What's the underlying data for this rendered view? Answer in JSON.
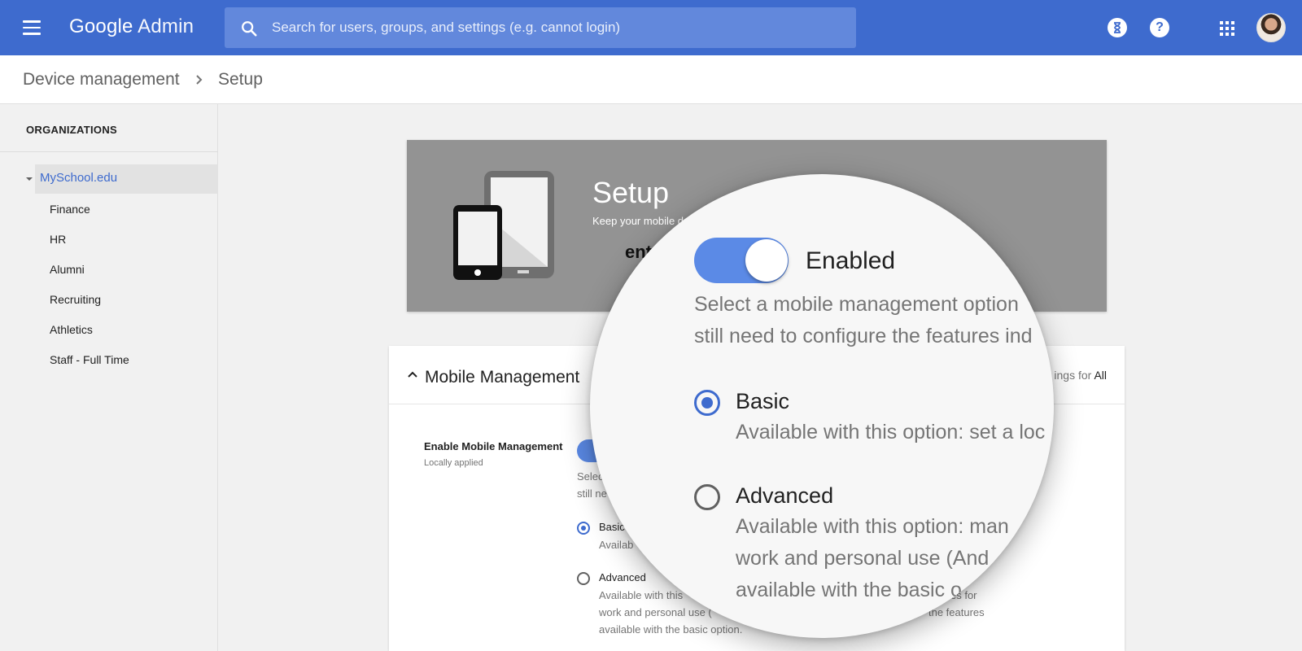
{
  "colors": {
    "topbar": "#3e6bce",
    "accent": "#3e6bce",
    "toggle": "#5b8ae6",
    "banner": "#939393"
  },
  "header": {
    "logo": "Google",
    "product": "Admin",
    "search_placeholder": "Search for users, groups, and settings (e.g. cannot login)",
    "icons": [
      "menu-icon",
      "search-icon",
      "hourglass-icon",
      "help-icon",
      "apps-icon",
      "avatar"
    ]
  },
  "breadcrumb": {
    "items": [
      "Device management",
      "Setup"
    ]
  },
  "sidebar": {
    "title": "ORGANIZATIONS",
    "root": "MySchool.edu",
    "children": [
      "Finance",
      "HR",
      "Alumni",
      "Recruiting",
      "Athletics",
      "Staff - Full Time"
    ]
  },
  "banner": {
    "title": "Setup",
    "subtitle": "Keep your mobile d",
    "fragment": "ent"
  },
  "card": {
    "title": "Mobile Management",
    "settings_for_prefix": "ings for",
    "settings_for_value": "All",
    "setting_label": "Enable Mobile Management",
    "setting_sub": "Locally applied",
    "desc_line1": "Selec",
    "desc_line2": "still ne",
    "basic_label": "Basic",
    "basic_desc": "Availab",
    "advanced_label": "Advanced",
    "advanced_desc_line1": "Available with this",
    "advanced_desc_line1_end": "es for",
    "advanced_desc_line2": "work and personal use (",
    "advanced_desc_line2_end": "the features",
    "advanced_desc_line3": "available with the basic option."
  },
  "magnifier": {
    "toggle_label": "Enabled",
    "toggle_on": true,
    "desc_line1": "Select a mobile management option",
    "desc_line2": "still need to configure the features ind",
    "basic_label": "Basic",
    "basic_desc": "Available with this option: set a loc",
    "advanced_label": "Advanced",
    "advanced_line1": "Available with this option: man",
    "advanced_line2": "work and personal use (And",
    "advanced_line3": "available with the basic o"
  }
}
